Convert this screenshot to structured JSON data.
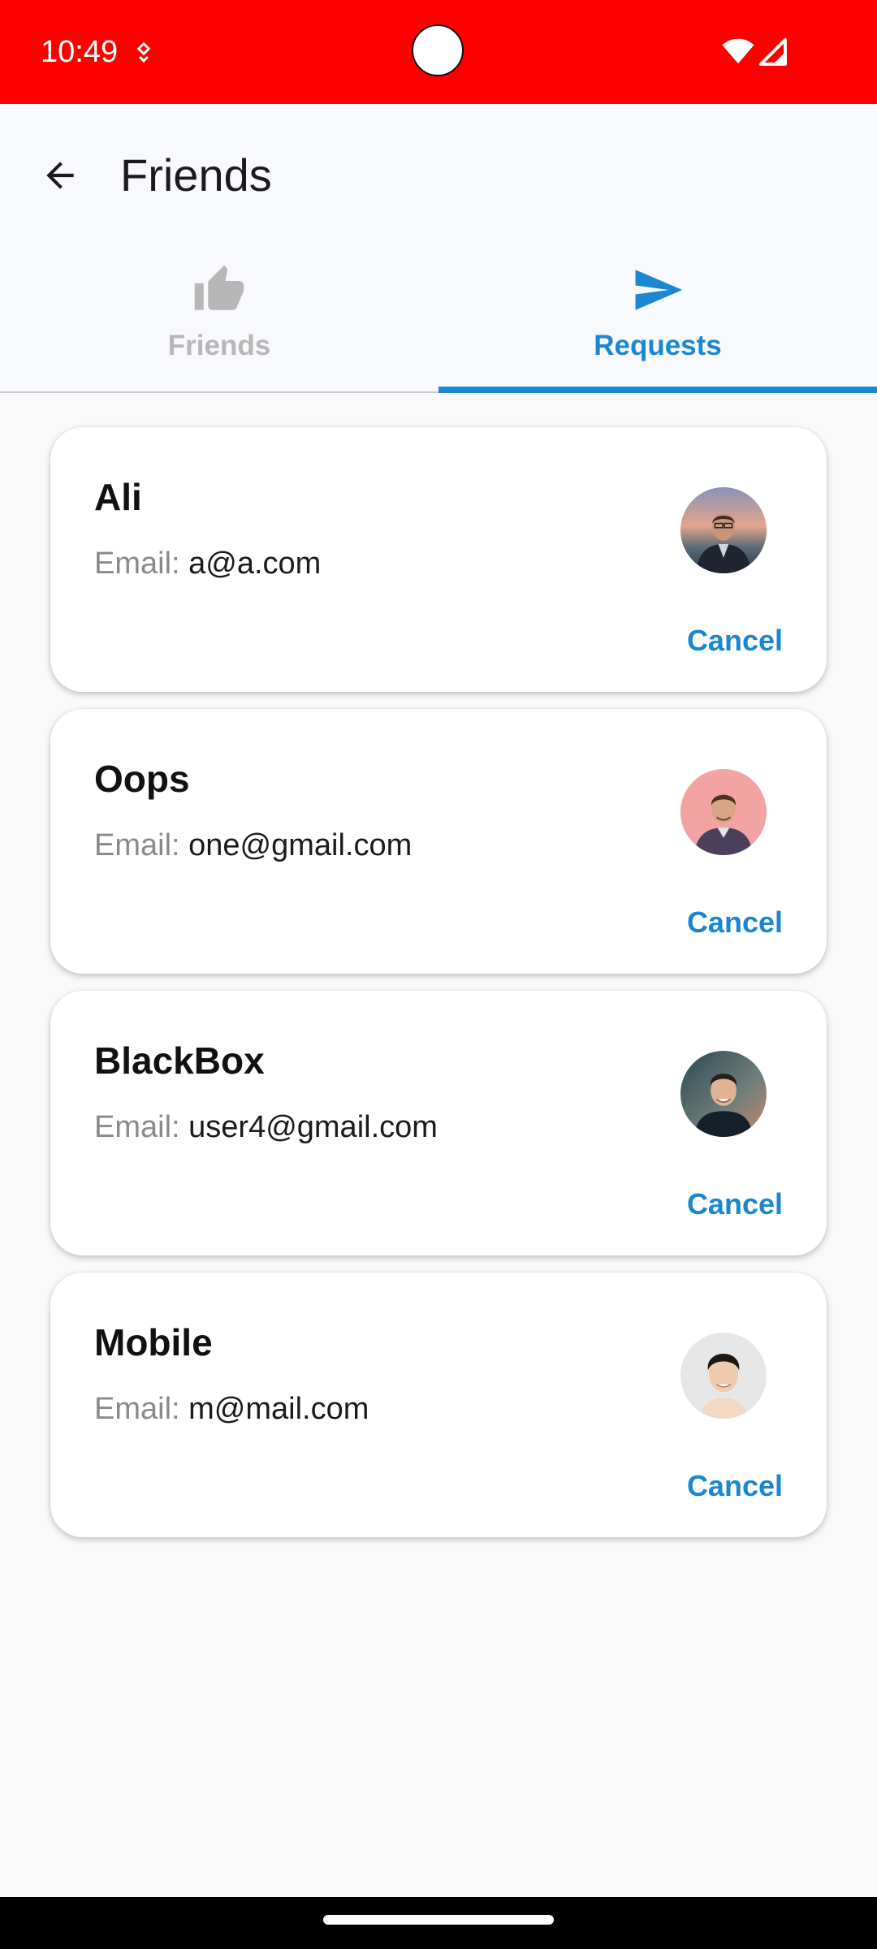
{
  "status_bar": {
    "time": "10:49",
    "background_color": "#ff0000"
  },
  "app_bar": {
    "title": "Friends",
    "back_icon": "arrow-back-icon"
  },
  "tabs": [
    {
      "label": "Friends",
      "icon": "thumbs-up-icon",
      "selected": false
    },
    {
      "label": "Requests",
      "icon": "send-icon",
      "selected": true
    }
  ],
  "accent_color": "#1b87d0",
  "requests": [
    {
      "name": "Ali",
      "email_label": "Email:",
      "email": "a@a.com",
      "action_label": "Cancel"
    },
    {
      "name": "Oops",
      "email_label": "Email:",
      "email": "one@gmail.com",
      "action_label": "Cancel"
    },
    {
      "name": "BlackBox",
      "email_label": "Email:",
      "email": "user4@gmail.com",
      "action_label": "Cancel"
    },
    {
      "name": "Mobile",
      "email_label": "Email:",
      "email": "m@mail.com",
      "action_label": "Cancel"
    }
  ]
}
